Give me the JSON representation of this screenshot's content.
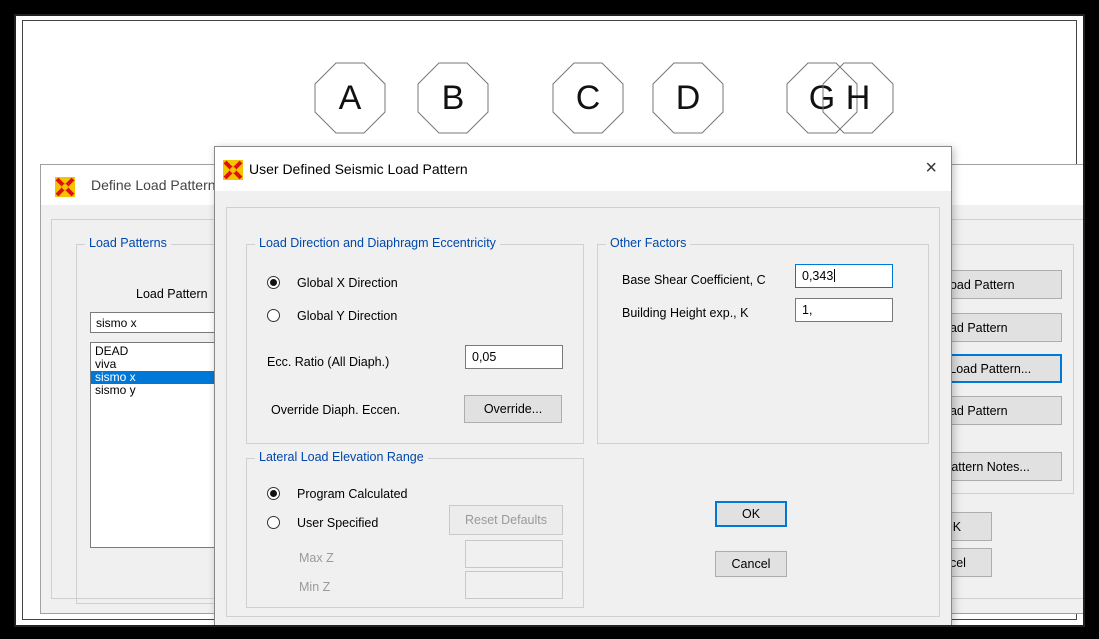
{
  "grid_labels": [
    "A",
    "B",
    "C",
    "D",
    "G",
    "H"
  ],
  "background_dialog": {
    "title": "Define Load Pattern",
    "group_title": "Load Patterns",
    "column_header": "Load Pattern",
    "name_field_value": "sismo x",
    "list_items": [
      "DEAD",
      "viva",
      "sismo x",
      "sismo y"
    ],
    "selected_item": "sismo x",
    "buttons": [
      "Load Pattern",
      "oad Pattern",
      "l Load Pattern...",
      "oad Pattern",
      "Pattern Notes..."
    ],
    "ok_label": "OK",
    "cancel_label": "ncel"
  },
  "dialog": {
    "title": "User Defined Seismic Load Pattern",
    "close_label": "×",
    "load_direction": {
      "group_title": "Load Direction and Diaphragm Eccentricity",
      "option_x": "Global  X  Direction",
      "option_y": "Global  Y  Direction",
      "selected": "x",
      "ecc_label": "Ecc. Ratio (All Diaph.)",
      "ecc_value": "0,05",
      "override_label": "Override Diaph. Eccen.",
      "override_button": "Override..."
    },
    "other_factors": {
      "group_title": "Other Factors",
      "base_shear_label": "Base Shear Coefficient, C",
      "base_shear_value": "0,343",
      "height_exp_label": "Building Height exp., K",
      "height_exp_value": "1,"
    },
    "lateral_load": {
      "group_title": "Lateral Load Elevation Range",
      "option_program": "Program Calculated",
      "option_user": "User Specified",
      "selected": "program",
      "reset_button": "Reset Defaults",
      "max_z_label": "Max Z",
      "min_z_label": "Min Z",
      "max_z_value": "",
      "min_z_value": ""
    },
    "ok_label": "OK",
    "cancel_label": "Cancel"
  }
}
